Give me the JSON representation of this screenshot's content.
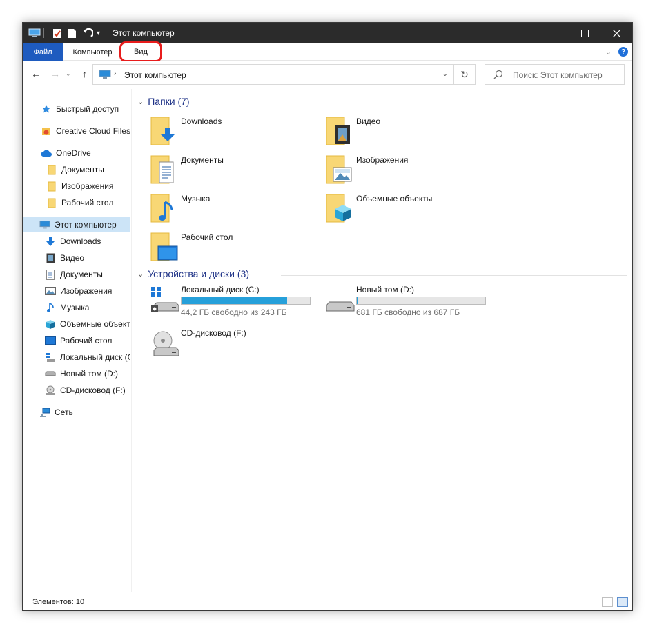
{
  "window": {
    "title": "Этот компьютер"
  },
  "ribbon": {
    "tabs": [
      {
        "label": "Файл"
      },
      {
        "label": "Компьютер"
      },
      {
        "label": "Вид"
      }
    ]
  },
  "address": {
    "path": "Этот компьютер"
  },
  "search": {
    "placeholder": "Поиск: Этот компьютер"
  },
  "sidebar": {
    "items": [
      {
        "label": "Быстрый доступ",
        "icon": "star-icon"
      },
      {
        "label": "Creative Cloud Files",
        "icon": "creative-cloud-icon"
      },
      {
        "label": "OneDrive",
        "icon": "cloud-icon"
      },
      {
        "label": "Документы",
        "icon": "folder-icon"
      },
      {
        "label": "Изображения",
        "icon": "folder-icon"
      },
      {
        "label": "Рабочий стол",
        "icon": "folder-icon"
      },
      {
        "label": "Этот компьютер",
        "icon": "computer-icon",
        "selected": true
      },
      {
        "label": "Downloads",
        "icon": "download-arrow-icon"
      },
      {
        "label": "Видео",
        "icon": "film-icon"
      },
      {
        "label": "Документы",
        "icon": "document-icon"
      },
      {
        "label": "Изображения",
        "icon": "picture-icon"
      },
      {
        "label": "Музыка",
        "icon": "music-note-icon"
      },
      {
        "label": "Объемные объекты",
        "icon": "cube-icon"
      },
      {
        "label": "Рабочий стол",
        "icon": "desktop-icon"
      },
      {
        "label": "Локальный диск (C:)",
        "icon": "system-drive-icon"
      },
      {
        "label": "Новый том (D:)",
        "icon": "drive-icon"
      },
      {
        "label": "CD-дисковод (F:)",
        "icon": "cd-drive-icon"
      },
      {
        "label": "Сеть",
        "icon": "network-icon"
      }
    ]
  },
  "folders_group": {
    "title": "Папки (7)",
    "items": [
      {
        "label": "Downloads",
        "icon": "downloads-folder-icon"
      },
      {
        "label": "Видео",
        "icon": "videos-folder-icon"
      },
      {
        "label": "Документы",
        "icon": "documents-folder-icon"
      },
      {
        "label": "Изображения",
        "icon": "pictures-folder-icon"
      },
      {
        "label": "Музыка",
        "icon": "music-folder-icon"
      },
      {
        "label": "Объемные объекты",
        "icon": "3d-objects-folder-icon"
      },
      {
        "label": "Рабочий стол",
        "icon": "desktop-folder-icon"
      }
    ]
  },
  "drives_group": {
    "title": "Устройства и диски (3)",
    "items": [
      {
        "label": "Локальный диск (C:)",
        "free": "44,2 ГБ свободно из 243 ГБ",
        "used_fraction": 0.82,
        "icon": "system-drive-icon"
      },
      {
        "label": "Новый том (D:)",
        "free": "681 ГБ свободно из 687 ГБ",
        "used_fraction": 0.01,
        "icon": "drive-icon"
      },
      {
        "label": "CD-дисковод (F:)",
        "icon": "cd-drive-icon"
      }
    ]
  },
  "status": {
    "items_count": "Элементов: 10"
  },
  "colors": {
    "accent": "#1e5bbf",
    "highlight": "#e81c1c",
    "bar": "#26a0da",
    "selection": "#cce4f7"
  }
}
